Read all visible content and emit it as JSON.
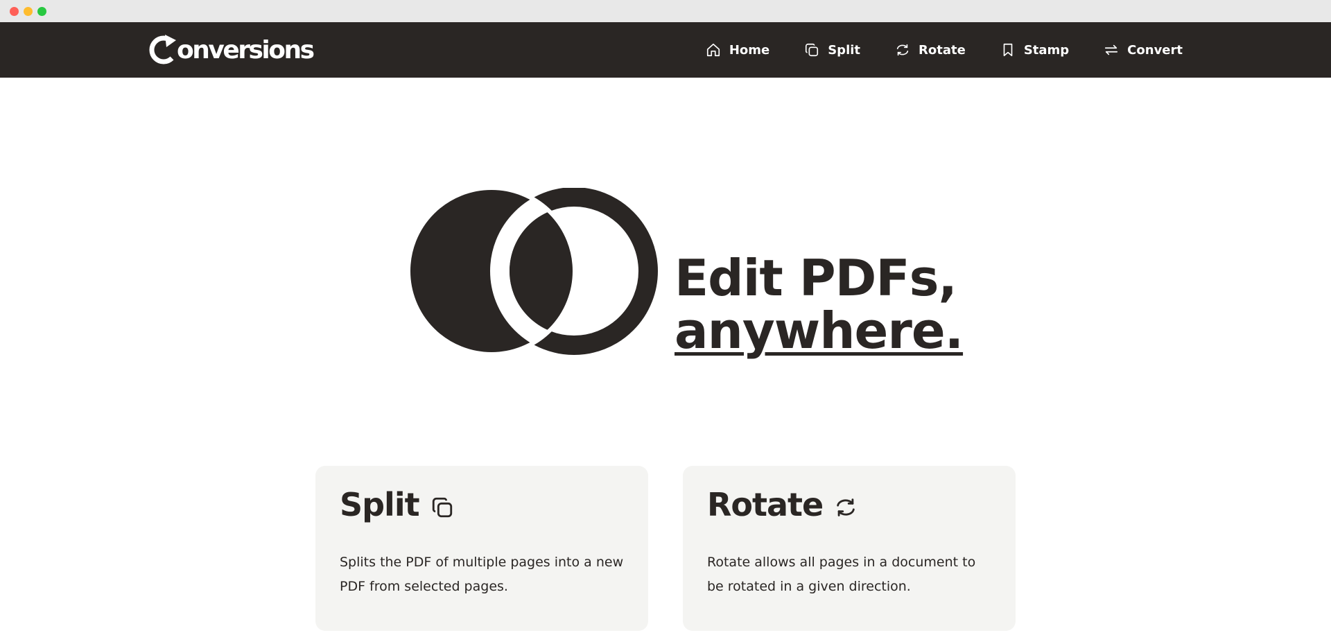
{
  "brand": {
    "logo_text": "onversions",
    "logo_icon": "refresh-c-icon"
  },
  "nav": {
    "items": [
      {
        "label": "Home",
        "icon": "home-icon"
      },
      {
        "label": "Split",
        "icon": "copy-icon"
      },
      {
        "label": "Rotate",
        "icon": "rotate-icon"
      },
      {
        "label": "Stamp",
        "icon": "bookmark-icon"
      },
      {
        "label": "Convert",
        "icon": "arrows-exchange-icon"
      }
    ]
  },
  "hero": {
    "line1": "Edit PDFs,",
    "line2": "anywhere.",
    "graphic": "overlapping-circles"
  },
  "cards": [
    {
      "title": "Split",
      "icon": "copy-icon",
      "description": "Splits the PDF of multiple pages into a new PDF from selected pages."
    },
    {
      "title": "Rotate",
      "icon": "rotate-icon",
      "description": "Rotate allows all pages in a document to be rotated in a given direction."
    }
  ],
  "colors": {
    "dark": "#2a2624",
    "card_bg": "#f4f4f2",
    "white": "#ffffff"
  }
}
